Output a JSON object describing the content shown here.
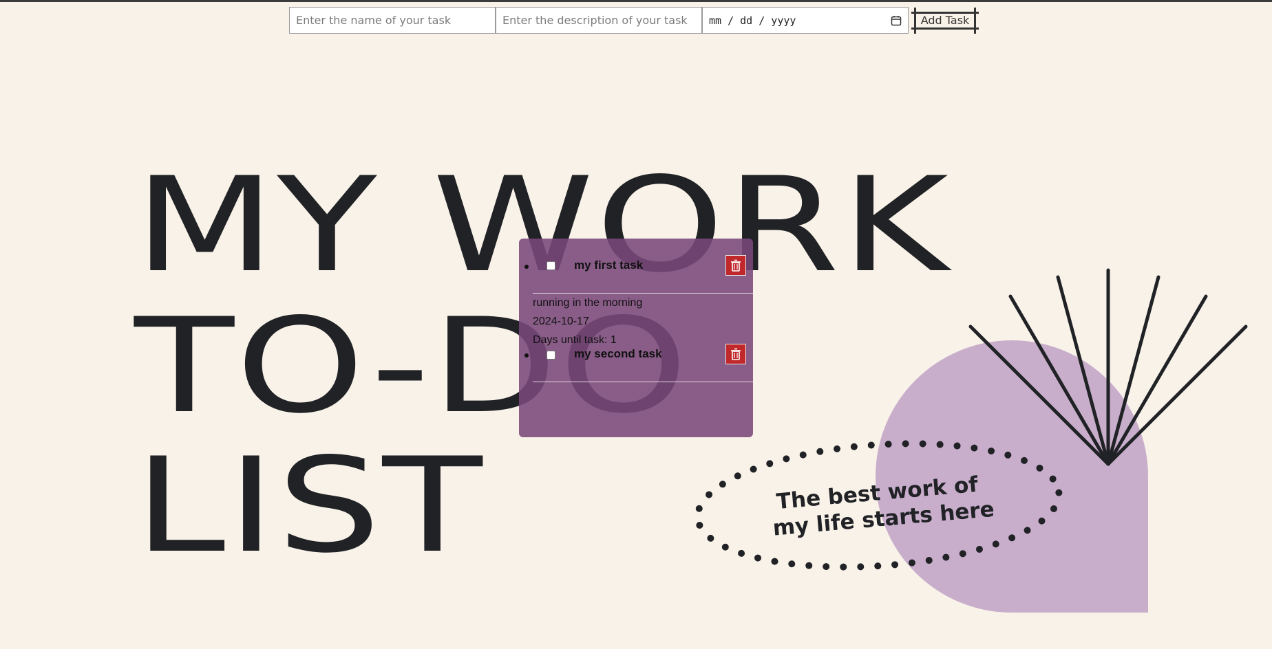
{
  "form": {
    "name_placeholder": "Enter the name of your task",
    "description_placeholder": "Enter the description of your task",
    "date_placeholder": "mm / dd / yyyy",
    "add_button_label": "Add Task"
  },
  "headline": {
    "line1": "MY WORK",
    "line2": "TO-DO",
    "line3": "LIST"
  },
  "tagline": {
    "line1": "The best work of",
    "line2": "my life starts here"
  },
  "tasks": [
    {
      "name": "my first task",
      "description": "running in the morning",
      "date": "2024-10-17",
      "days_until": "Days until task: 1"
    },
    {
      "name": "my second task"
    }
  ],
  "icons": {
    "date": "calendar-icon",
    "delete": "trash-icon",
    "decoration": "sunburst-lines"
  },
  "colors": {
    "background": "#f9f2e8",
    "text": "#202226",
    "panel": "#79487a",
    "blob": "#c8aecb",
    "delete": "#c0282b"
  }
}
